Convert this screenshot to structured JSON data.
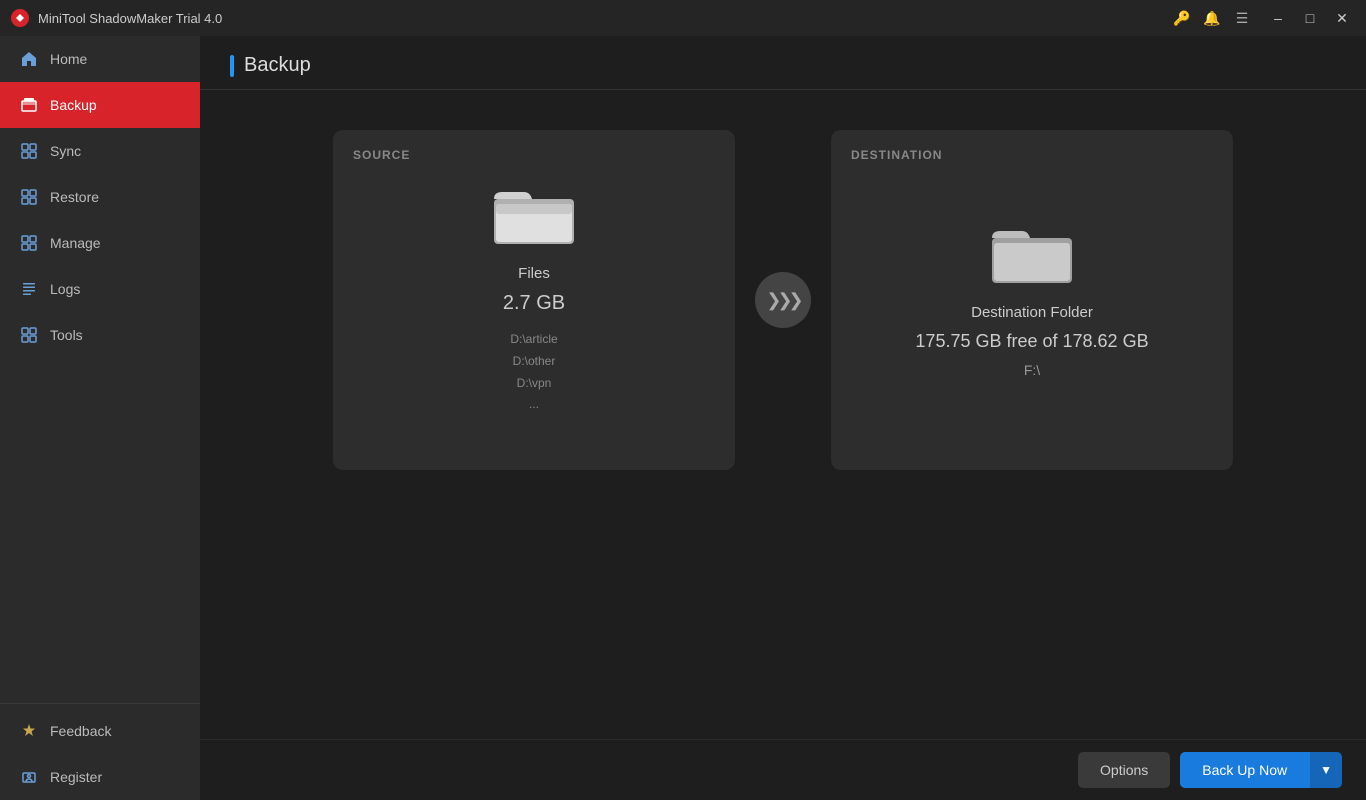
{
  "app": {
    "title": "MiniTool ShadowMaker Trial 4.0"
  },
  "title_buttons": {
    "pin": "📌",
    "bell": "🔔",
    "menu": "☰",
    "minimize": "–",
    "maximize": "❐",
    "close": "✕"
  },
  "sidebar": {
    "items": [
      {
        "id": "home",
        "label": "Home",
        "icon": "home"
      },
      {
        "id": "backup",
        "label": "Backup",
        "icon": "backup",
        "active": true
      },
      {
        "id": "sync",
        "label": "Sync",
        "icon": "sync"
      },
      {
        "id": "restore",
        "label": "Restore",
        "icon": "restore"
      },
      {
        "id": "manage",
        "label": "Manage",
        "icon": "manage"
      },
      {
        "id": "logs",
        "label": "Logs",
        "icon": "logs"
      },
      {
        "id": "tools",
        "label": "Tools",
        "icon": "tools"
      }
    ],
    "bottom": [
      {
        "id": "feedback",
        "label": "Feedback",
        "icon": "feedback"
      },
      {
        "id": "register",
        "label": "Register",
        "icon": "register"
      }
    ]
  },
  "page": {
    "title": "Backup"
  },
  "source": {
    "label": "SOURCE",
    "icon": "folder-open",
    "name": "Files",
    "size": "2.7 GB",
    "paths": [
      "D:\\article",
      "D:\\other",
      "D:\\vpn",
      "..."
    ]
  },
  "destination": {
    "label": "DESTINATION",
    "icon": "folder",
    "name": "Destination Folder",
    "free": "175.75 GB free of 178.62 GB",
    "drive": "F:\\"
  },
  "buttons": {
    "options": "Options",
    "backup_now": "Back Up Now",
    "arrow": "▼"
  }
}
